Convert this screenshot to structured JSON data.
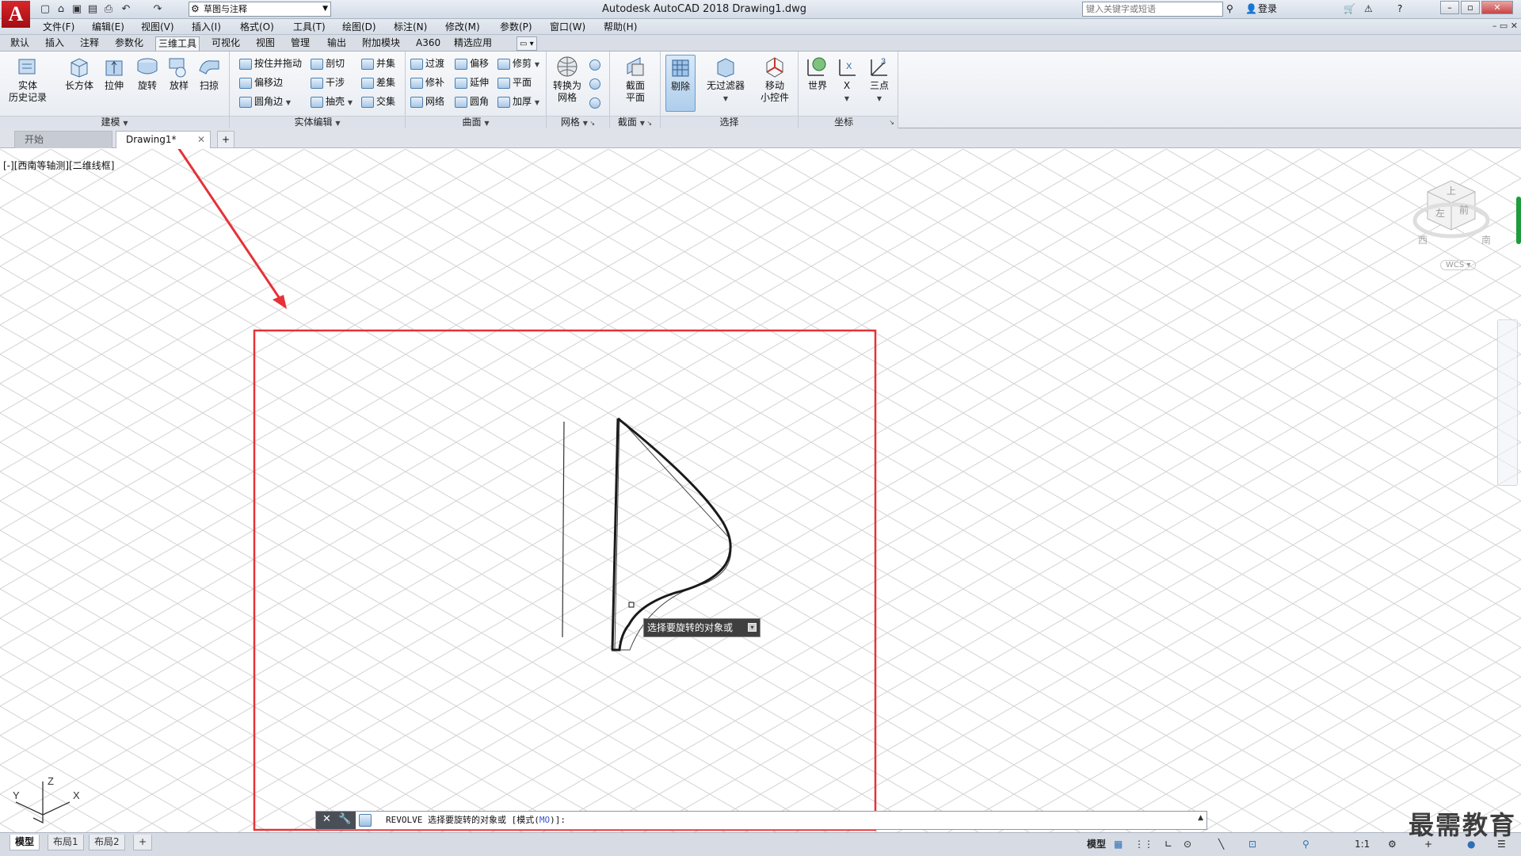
{
  "titlebar": {
    "logo": "A",
    "workspace": "草图与注释",
    "title": "Autodesk AutoCAD 2018    Drawing1.dwg",
    "search_placeholder": "键入关键字或短语",
    "login": "登录"
  },
  "menu": [
    "文件(F)",
    "编辑(E)",
    "视图(V)",
    "插入(I)",
    "格式(O)",
    "工具(T)",
    "绘图(D)",
    "标注(N)",
    "修改(M)",
    "参数(P)",
    "窗口(W)",
    "帮助(H)"
  ],
  "ribbon_tabs": [
    "默认",
    "插入",
    "注释",
    "参数化",
    "三维工具",
    "可视化",
    "视图",
    "管理",
    "输出",
    "附加模块",
    "A360",
    "精选应用"
  ],
  "ribbon_active_tab": "三维工具",
  "panels": {
    "modeling": {
      "title": "建模",
      "buttons": [
        "实体\n历史记录",
        "长方体",
        "拉伸",
        "旋转",
        "放样",
        "扫掠"
      ]
    },
    "solid_edit": {
      "title": "实体编辑",
      "buttons": [
        "按住并拖动",
        "偏移边",
        "圆角边",
        "剖切",
        "干涉",
        "抽壳",
        "并集",
        "差集",
        "交集"
      ]
    },
    "surface": {
      "title": "曲面",
      "buttons": [
        "过渡",
        "修补",
        "网络",
        "偏移",
        "延伸",
        "圆角",
        "修剪",
        "平面",
        "加厚"
      ]
    },
    "mesh": {
      "title": "网格",
      "buttons": [
        "转换为\n网格"
      ]
    },
    "section": {
      "title": "截面",
      "buttons": [
        "截面\n平面"
      ]
    },
    "selection": {
      "title": "选择",
      "buttons": [
        "剔除",
        "无过滤器",
        "移动\n小控件"
      ]
    },
    "coords": {
      "title": "坐标",
      "buttons": [
        "世界",
        "X",
        "三点"
      ]
    }
  },
  "file_tabs": {
    "start": "开始",
    "drawing": "Drawing1*"
  },
  "viewport_label": "[-][西南等轴测][二维线框]",
  "viewcube": {
    "top": "上",
    "left": "左",
    "front": "前",
    "west": "西",
    "south": "南",
    "wcs": "WCS"
  },
  "tooltip": "选择要旋转的对象或",
  "command": {
    "prefix": "REVOLVE 选择要旋转的对象或 [模式(",
    "kw": "MO",
    "suffix": ")]:"
  },
  "ucs": {
    "x": "X",
    "y": "Y",
    "z": "Z"
  },
  "layout_tabs": [
    "模型",
    "布局1",
    "布局2"
  ],
  "status": {
    "model": "模型",
    "scale": "1:1"
  },
  "watermark": "最需教育",
  "colors": {
    "highlight": "#e53238",
    "accent_blue": "#3b56d6"
  }
}
